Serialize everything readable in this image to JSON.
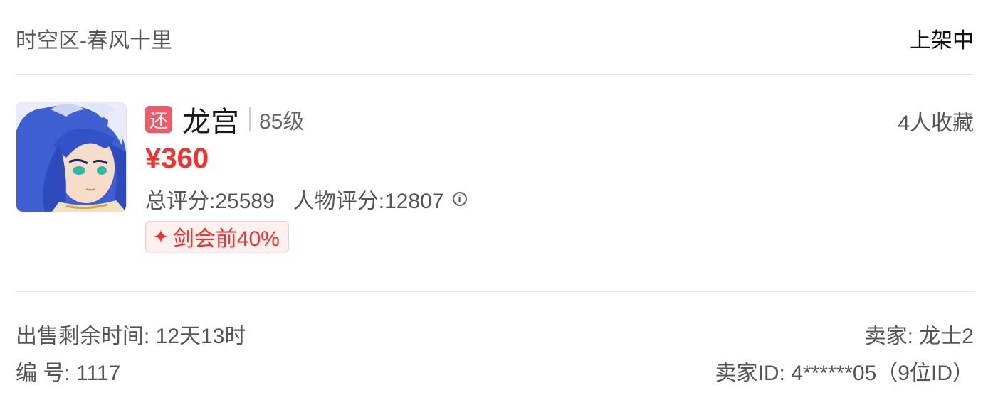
{
  "header": {
    "server": "时空区-春风十里",
    "status": "上架中"
  },
  "item": {
    "badge": "还",
    "role": "龙宫",
    "level": "85级",
    "favorites": "4人收藏",
    "price": "¥360",
    "total_score": "总评分:25589",
    "character_score": "人物评分:12807",
    "info_icon_glyph": "i",
    "tag_icon": "✦",
    "tag_text": "剑会前40%"
  },
  "footer": {
    "remaining_time": "出售剩余时间: 12天13时",
    "number": "编 号: 1117",
    "seller": "卖家: 龙士2",
    "seller_id": "卖家ID: 4******05（9位ID）"
  },
  "colors": {
    "price": "#f5302c",
    "badge": "#ef5a6b",
    "tag_bg": "#fff0f0"
  }
}
